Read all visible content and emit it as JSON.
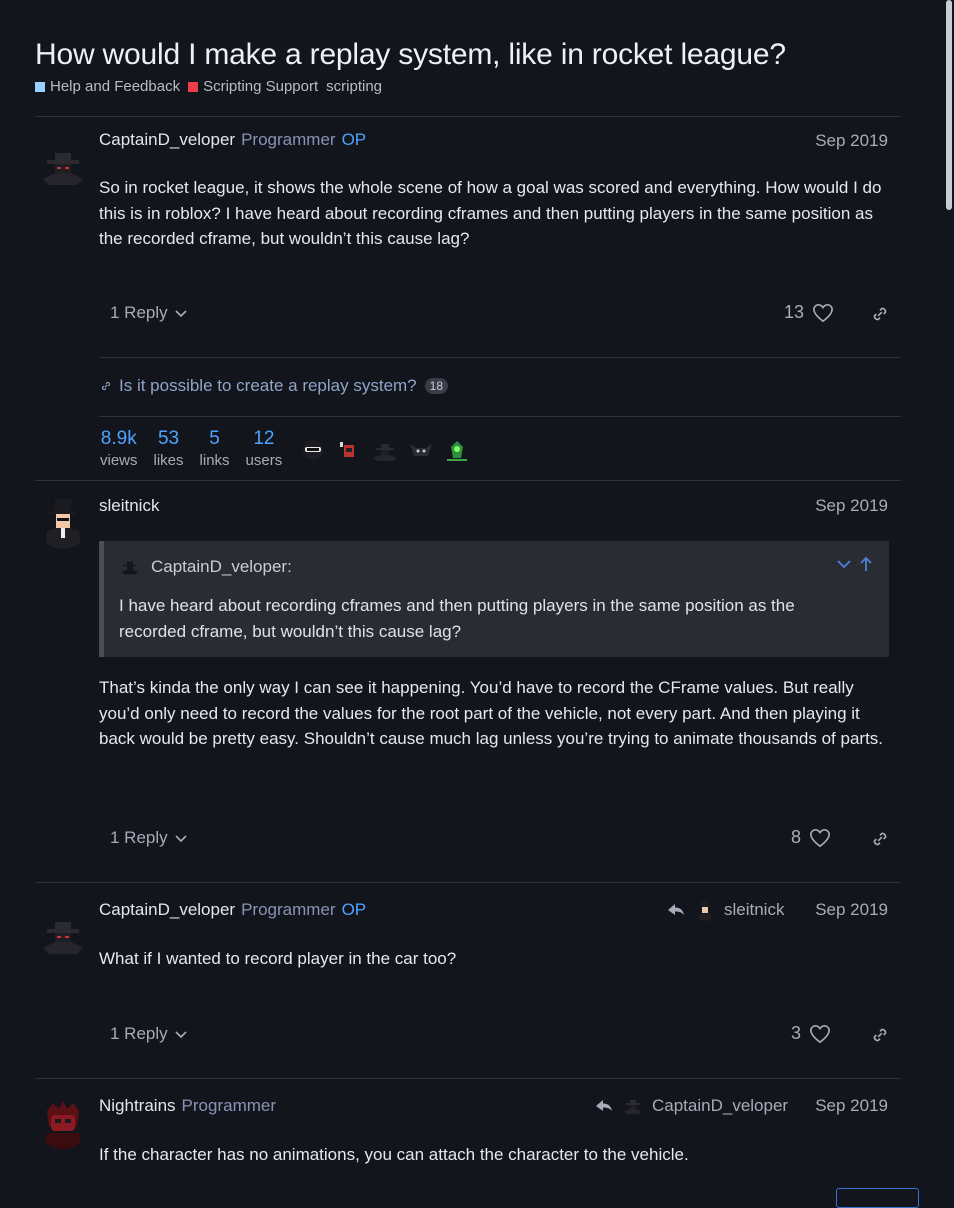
{
  "topic": {
    "title": "How would I make a replay system, like in rocket league?",
    "categories": [
      {
        "label": "Help and Feedback",
        "color": "#9ad0ff"
      },
      {
        "label": "Scripting Support",
        "color": "#ed3e4b"
      }
    ],
    "tag": "scripting"
  },
  "posts": [
    {
      "username": "CaptainD_veloper",
      "flair": "Programmer",
      "op_badge": "OP",
      "date": "Sep 2019",
      "body": "So in rocket league, it shows the whole scene of how a goal was scored and everything. How would I do this is in roblox? I have heard about recording cframes and then putting players in the same position as the recorded cframe, but wouldn’t this cause lag?",
      "reply_label": "1 Reply",
      "likes": "13"
    },
    {
      "username": "sleitnick",
      "date": "Sep 2019",
      "quote_author": "CaptainD_veloper:",
      "quote_text": "I have heard about recording cframes and then putting players in the same position as the recorded cframe, but wouldn’t this cause lag?",
      "body": "That’s kinda the only way I can see it happening. You’d have to record the CFrame values. But really you’d only need to record the values for the root part of the vehicle, not every part. And then playing it back would be pretty easy. Shouldn’t cause much lag unless you’re trying to animate thousands of parts.",
      "reply_label": "1 Reply",
      "likes": "8"
    },
    {
      "username": "CaptainD_veloper",
      "flair": "Programmer",
      "op_badge": "OP",
      "reply_to": "sleitnick",
      "date": "Sep 2019",
      "body": "What if I wanted to record player in the car too?",
      "reply_label": "1 Reply",
      "likes": "3"
    },
    {
      "username": "Nightrains",
      "flair": "Programmer",
      "reply_to": "CaptainD_veloper",
      "date": "Sep 2019",
      "body": "If the character has no animations, you can attach the character to the vehicle."
    }
  ],
  "linked_topic": {
    "title": "Is it possible to create a replay system?",
    "count": "18"
  },
  "stats": [
    {
      "num": "8.9k",
      "label": "views"
    },
    {
      "num": "53",
      "label": "likes"
    },
    {
      "num": "5",
      "label": "links"
    },
    {
      "num": "12",
      "label": "users"
    }
  ],
  "colors": {
    "accent": "#4da3ff",
    "background": "#13151c"
  },
  "icons": [
    "chevron-down-icon",
    "heart-icon",
    "link-icon",
    "reply-arrow-icon",
    "arrow-up-icon"
  ]
}
